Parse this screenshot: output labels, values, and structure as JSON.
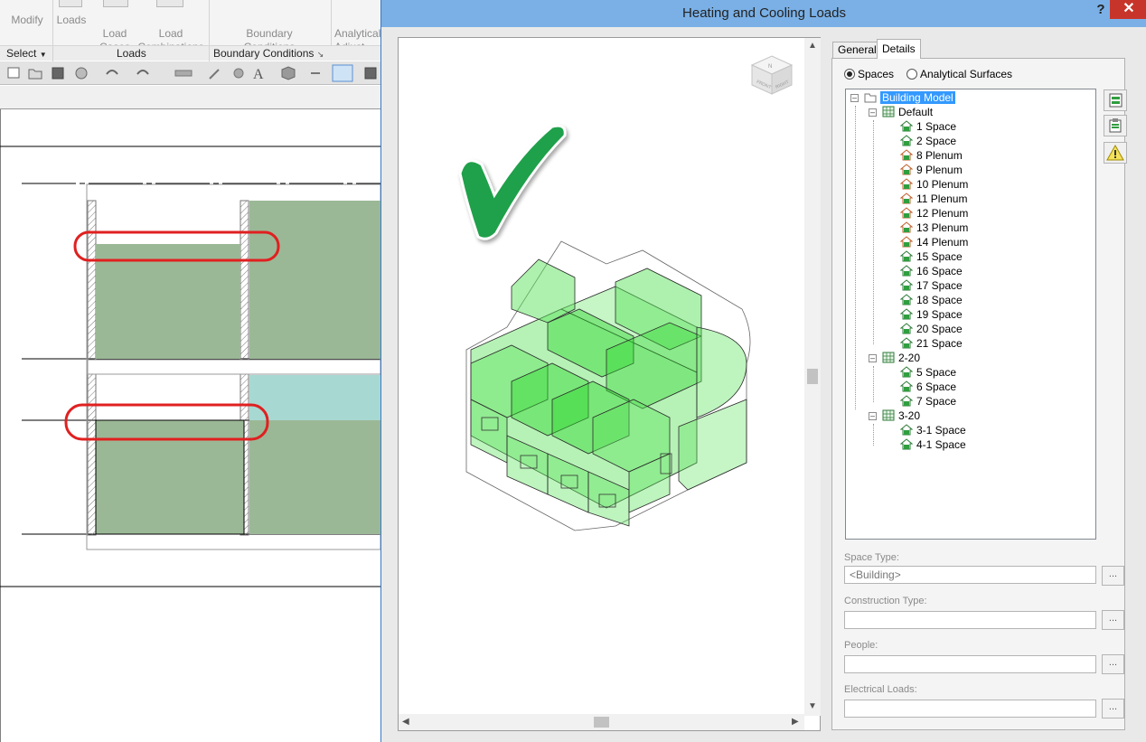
{
  "ribbon": {
    "modify_label": "Modify",
    "loads_label": "Loads",
    "load_cases_label": "Load\nCases",
    "load_combinations_label": "Load\nCombinations",
    "boundary_conditions_label": "Boundary\nConditions",
    "analytical_adjust_label": "Analytical\nAdjust",
    "groups": {
      "select": "Select",
      "loads": "Loads",
      "boundary_conditions": "Boundary Conditions"
    }
  },
  "dialog": {
    "title": "Heating and Cooling Loads",
    "help_label": "?",
    "close_label": "✕",
    "tabs": {
      "general": "General",
      "details": "Details"
    },
    "radio": {
      "spaces": "Spaces",
      "analytical_surfaces": "Analytical Surfaces",
      "selected": "spaces"
    },
    "view_cube": {
      "left_face": "FRONT",
      "right_face": "RIGHT",
      "top_face": "N"
    },
    "tree": {
      "root": "Building Model",
      "groups": [
        {
          "label": "Default",
          "items": [
            {
              "label": "1 Space",
              "kind": "space"
            },
            {
              "label": "2 Space",
              "kind": "space"
            },
            {
              "label": "8 Plenum",
              "kind": "plenum"
            },
            {
              "label": "9 Plenum",
              "kind": "plenum"
            },
            {
              "label": "10 Plenum",
              "kind": "plenum"
            },
            {
              "label": "11 Plenum",
              "kind": "plenum"
            },
            {
              "label": "12 Plenum",
              "kind": "plenum"
            },
            {
              "label": "13 Plenum",
              "kind": "plenum"
            },
            {
              "label": "14 Plenum",
              "kind": "plenum"
            },
            {
              "label": "15 Space",
              "kind": "space"
            },
            {
              "label": "16 Space",
              "kind": "space"
            },
            {
              "label": "17 Space",
              "kind": "space"
            },
            {
              "label": "18 Space",
              "kind": "space"
            },
            {
              "label": "19 Space",
              "kind": "space"
            },
            {
              "label": "20 Space",
              "kind": "space"
            },
            {
              "label": "21 Space",
              "kind": "space"
            }
          ]
        },
        {
          "label": "2-20",
          "items": [
            {
              "label": "5 Space",
              "kind": "space"
            },
            {
              "label": "6 Space",
              "kind": "space"
            },
            {
              "label": "7 Space",
              "kind": "space"
            }
          ]
        },
        {
          "label": "3-20",
          "items": [
            {
              "label": "3-1 Space",
              "kind": "space"
            },
            {
              "label": "4-1 Space",
              "kind": "space"
            }
          ]
        }
      ]
    },
    "fields": {
      "space_type_label": "Space Type:",
      "space_type_value": "<Building>",
      "construction_type_label": "Construction Type:",
      "construction_type_value": "",
      "people_label": "People:",
      "people_value": "",
      "electrical_loads_label": "Electrical Loads:",
      "electrical_loads_value": "",
      "browse_label": "..."
    }
  },
  "colors": {
    "titlebar": "#7ab0e6",
    "close": "#c7352a",
    "space_fill": "#9bb896",
    "teal_fill": "#a8d8d2",
    "highlight_ring": "#e02020",
    "check": "#1fa04a",
    "model_green": "#5de35d",
    "selection": "#3399ff"
  }
}
